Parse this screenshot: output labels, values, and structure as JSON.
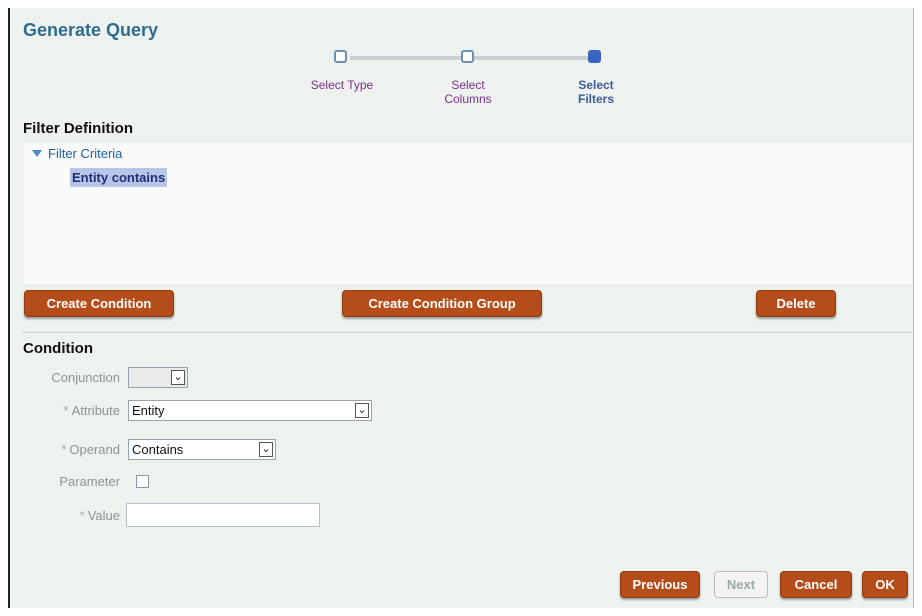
{
  "dialog": {
    "title": "Generate Query"
  },
  "train": {
    "steps": [
      {
        "label_line1": "Select Type",
        "label_line2": ""
      },
      {
        "label_line1": "Select",
        "label_line2": "Columns"
      },
      {
        "label_line1": "Select",
        "label_line2": "Filters"
      }
    ],
    "current_step": 3
  },
  "filter_definition": {
    "heading": "Filter Definition",
    "root_label": "Filter Criteria",
    "child_label": "Entity contains"
  },
  "actions": {
    "create_condition": "Create Condition",
    "create_condition_group": "Create Condition Group",
    "delete": "Delete"
  },
  "condition": {
    "heading": "Condition",
    "conjunction_label": "Conjunction",
    "conjunction_value": "",
    "attribute_label": "Attribute",
    "attribute_value": "Entity",
    "operand_label": "Operand",
    "operand_value": "Contains",
    "parameter_label": "Parameter",
    "value_label": "Value",
    "value_value": "",
    "required_marker": "*"
  },
  "footer": {
    "previous": "Previous",
    "next": "Next",
    "cancel": "Cancel",
    "ok": "OK"
  },
  "colors": {
    "button_bg": "#b54d1a",
    "title": "#2f6c8f",
    "dialog_bg": "#edf2ef",
    "train_current": "#3a63c2"
  },
  "icons": {
    "expand": "triangle-down",
    "dropdown": "chevron-down"
  }
}
